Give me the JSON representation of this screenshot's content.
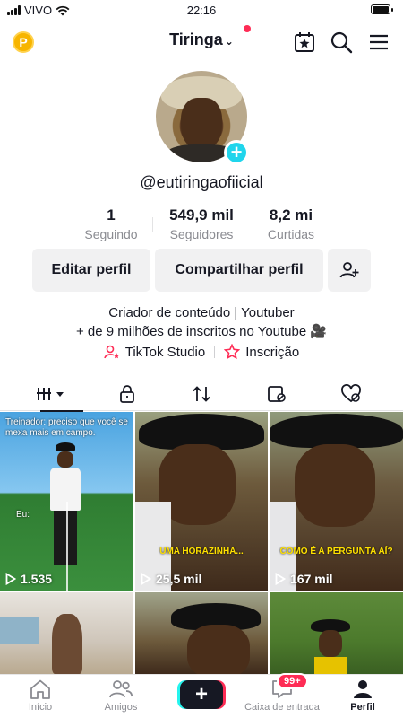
{
  "status_bar": {
    "carrier": "VIVO",
    "time": "22:16"
  },
  "header": {
    "username": "Tiringa",
    "chevron": "⌄",
    "coin_label": "P"
  },
  "profile": {
    "handle": "@eutiringaofiicial",
    "add_symbol": "+",
    "stats": [
      {
        "value": "1",
        "label": "Seguindo"
      },
      {
        "value": "549,9 mil",
        "label": "Seguidores"
      },
      {
        "value": "8,2 mi",
        "label": "Curtidas"
      }
    ],
    "buttons": {
      "edit": "Editar perfil",
      "share": "Compartilhar perfil"
    },
    "bio": [
      "Criador de conteúdo | Youtuber",
      "+ de 9 milhões de inscritos no Youtube 🎥"
    ],
    "links": [
      {
        "label": "TikTok Studio"
      },
      {
        "label": "Inscrição"
      }
    ]
  },
  "videos": [
    {
      "views": "1.535",
      "caption": "Treinador: preciso que você se mexa mais em campo.",
      "sub": "Eu:"
    },
    {
      "views": "25,5 mil",
      "caption": "UMA HORAZINHA..."
    },
    {
      "views": "167 mil",
      "caption": "COMO É A PERGUNTA AÍ?"
    },
    {
      "views": ""
    },
    {
      "views": ""
    },
    {
      "views": ""
    }
  ],
  "bottom_nav": {
    "items": [
      {
        "label": "Início"
      },
      {
        "label": "Amigos"
      },
      {
        "label": ""
      },
      {
        "label": "Caixa de entrada"
      },
      {
        "label": "Perfil"
      }
    ],
    "inbox_badge": "99+"
  },
  "colors": {
    "accent": "#fe2c55",
    "cyan": "#20d5ec",
    "text": "#161823",
    "muted": "#8a8b91",
    "button_bg": "#f1f1f2"
  }
}
